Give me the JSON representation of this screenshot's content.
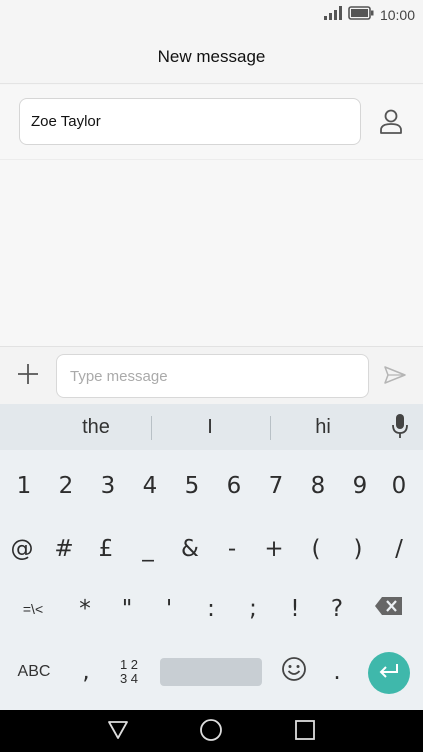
{
  "status_bar": {
    "time": "10:00",
    "icons": [
      "signal-icon",
      "battery-icon"
    ]
  },
  "header": {
    "title": "New message"
  },
  "recipient": {
    "value": "Zoe Taylor",
    "contact_icon": "contact-person-icon"
  },
  "compose": {
    "attach_icon": "plus-icon",
    "placeholder": "Type message",
    "send_icon": "send-icon"
  },
  "keyboard": {
    "suggestions": [
      "the",
      "I",
      "hi"
    ],
    "mic_icon": "microphone-icon",
    "row_numbers": [
      "1",
      "2",
      "3",
      "4",
      "5",
      "6",
      "7",
      "8",
      "9",
      "0"
    ],
    "row_symbols_1": [
      "@",
      "#",
      "£",
      "_",
      "&",
      "-",
      "+",
      "(",
      ")",
      "/"
    ],
    "row_symbols_2": [
      "=\\<",
      "*",
      "\"",
      "'",
      ":",
      ";",
      "!",
      "?"
    ],
    "backspace_icon": "backspace-icon",
    "bottom": {
      "abc": "ABC",
      "comma": ",",
      "num_switch_top": "1 2",
      "num_switch_bottom": "3 4",
      "emoji_icon": "emoji-icon",
      "period": ".",
      "enter_icon": "enter-icon"
    }
  },
  "nav_bar": {
    "icons": [
      "back-icon",
      "home-icon",
      "recents-icon"
    ]
  },
  "colors": {
    "accent": "#3fb8ab",
    "keyboard_bg": "#ecf0f3",
    "suggestion_bg": "#e3e8ec",
    "nav_bg": "#000000"
  }
}
